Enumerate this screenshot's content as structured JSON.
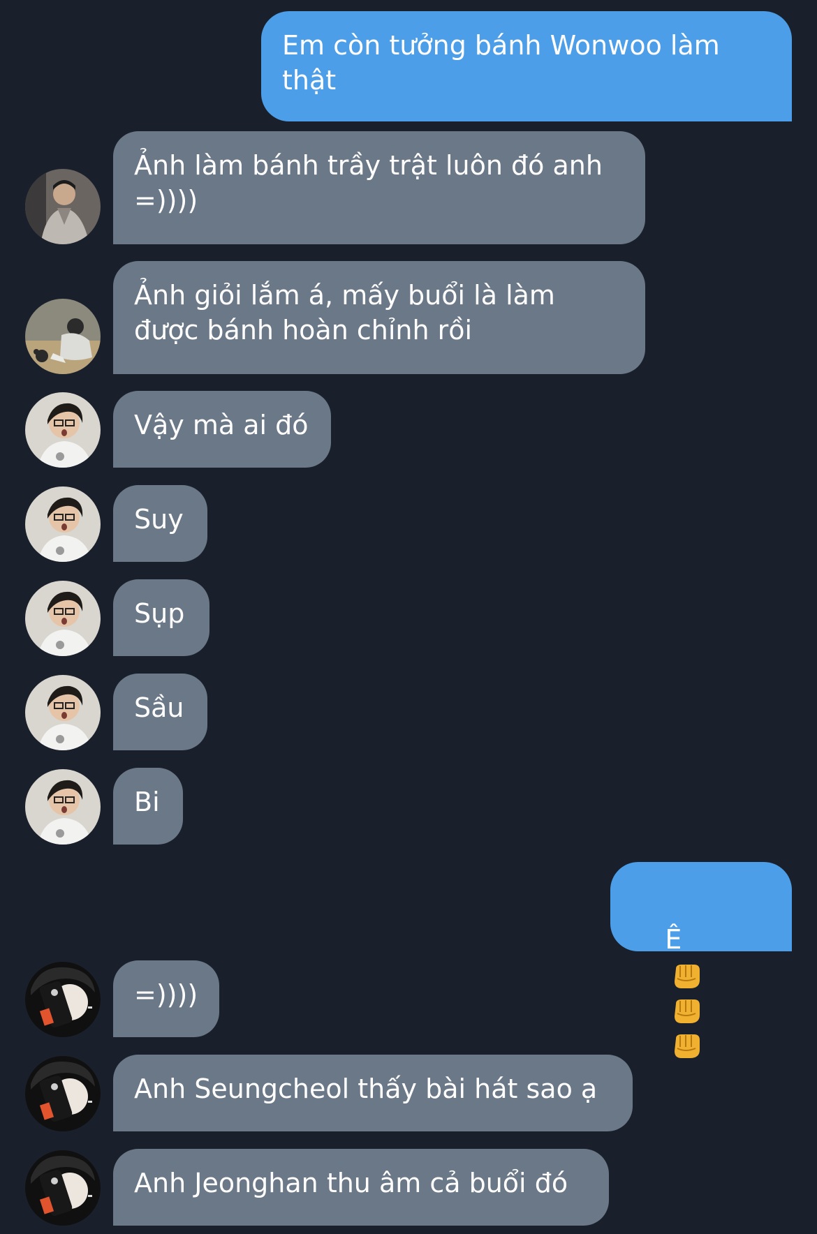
{
  "colors": {
    "background": "#1a202b",
    "incoming_bubble": "#6b7888",
    "outgoing_bubble": "#4d9ee8",
    "text": "#ffffff"
  },
  "messages": [
    {
      "direction": "out",
      "text": "Em còn tưởng bánh Wonwoo làm thật"
    },
    {
      "direction": "in",
      "avatar": "avatar-a",
      "text": "Ảnh làm bánh trầy trật luôn đó anh =))))"
    },
    {
      "direction": "in",
      "avatar": "avatar-b",
      "text": "Ảnh giỏi lắm á, mấy buổi là làm được bánh hoàn chỉnh rồi"
    },
    {
      "direction": "in",
      "avatar": "avatar-c",
      "text": "Vậy mà ai đó"
    },
    {
      "direction": "in",
      "avatar": "avatar-c",
      "text": "Suy"
    },
    {
      "direction": "in",
      "avatar": "avatar-c",
      "text": "Sụp"
    },
    {
      "direction": "in",
      "avatar": "avatar-c",
      "text": "Sầu"
    },
    {
      "direction": "in",
      "avatar": "avatar-c",
      "text": "Bi"
    },
    {
      "direction": "out",
      "text": "Ê",
      "emoji": [
        "fist-icon",
        "fist-icon",
        "fist-icon"
      ]
    },
    {
      "direction": "in",
      "avatar": "avatar-d",
      "text": "=))))"
    },
    {
      "direction": "in",
      "avatar": "avatar-d",
      "text": "Anh Seungcheol thấy bài hát sao ạ"
    },
    {
      "direction": "in",
      "avatar": "avatar-d",
      "text": "Anh Jeonghan thu âm cả buổi đó"
    }
  ]
}
